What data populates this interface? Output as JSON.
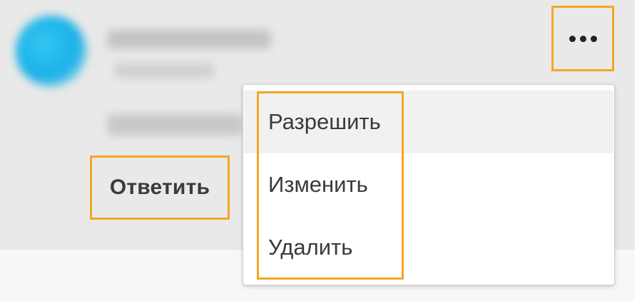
{
  "comment": {
    "reply_label": "Ответить"
  },
  "more_button": {
    "icon": "more-horizontal-icon"
  },
  "menu": {
    "items": [
      {
        "label": "Разрешить"
      },
      {
        "label": "Изменить"
      },
      {
        "label": "Удалить"
      }
    ]
  },
  "colors": {
    "highlight": "#f5a623",
    "avatar": "#1fb5e8",
    "card_background": "#e9e9e9",
    "menu_background": "#ffffff"
  }
}
